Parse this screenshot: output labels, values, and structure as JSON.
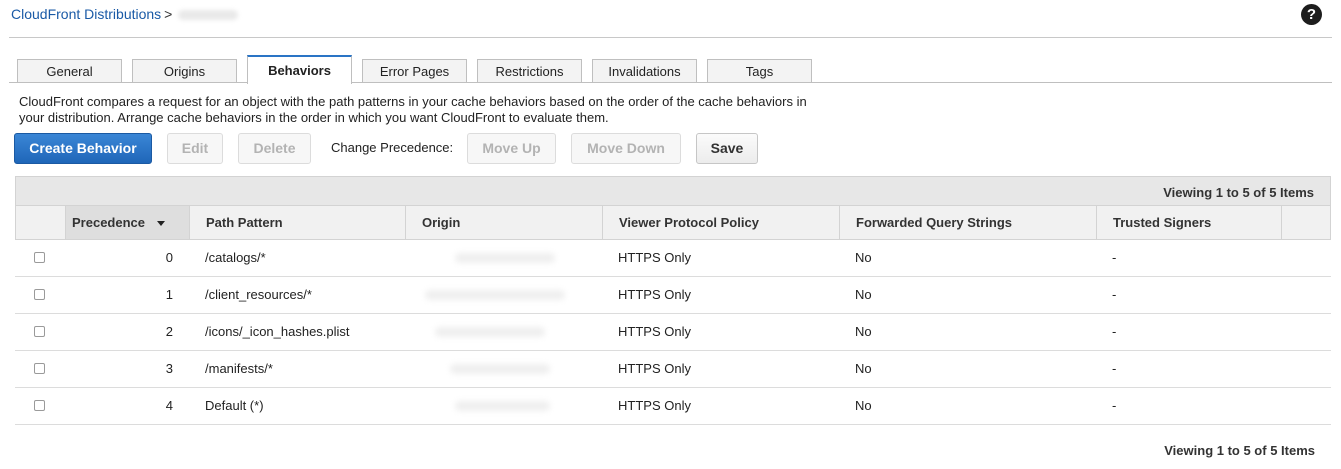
{
  "breadcrumb": {
    "link": "CloudFront Distributions",
    "separator": ">"
  },
  "help": {
    "glyph": "?"
  },
  "tabs": [
    {
      "label": "General",
      "active": false
    },
    {
      "label": "Origins",
      "active": false
    },
    {
      "label": "Behaviors",
      "active": true
    },
    {
      "label": "Error Pages",
      "active": false
    },
    {
      "label": "Restrictions",
      "active": false
    },
    {
      "label": "Invalidations",
      "active": false
    },
    {
      "label": "Tags",
      "active": false
    }
  ],
  "description": "CloudFront compares a request for an object with the path patterns in your cache behaviors based on the order of the cache behaviors in your distribution. Arrange cache behaviors in the order in which you want CloudFront to evaluate them.",
  "toolbar": {
    "create": "Create Behavior",
    "edit": "Edit",
    "delete": "Delete",
    "precedence_label": "Change Precedence:",
    "move_up": "Move Up",
    "move_down": "Move Down",
    "save": "Save"
  },
  "grid": {
    "viewing_top": "Viewing 1 to 5 of 5 Items",
    "viewing_bottom": "Viewing 1 to 5 of 5 Items",
    "columns": {
      "precedence": "Precedence",
      "path_pattern": "Path Pattern",
      "origin": "Origin",
      "viewer_protocol_policy": "Viewer Protocol Policy",
      "forwarded_query_strings": "Forwarded Query Strings",
      "trusted_signers": "Trusted Signers"
    },
    "rows": [
      {
        "precedence": "0",
        "path": "/catalogs/*",
        "policy": "HTTPS Only",
        "query": "No",
        "signers": "-"
      },
      {
        "precedence": "1",
        "path": "/client_resources/*",
        "policy": "HTTPS Only",
        "query": "No",
        "signers": "-"
      },
      {
        "precedence": "2",
        "path": "/icons/_icon_hashes.plist",
        "policy": "HTTPS Only",
        "query": "No",
        "signers": "-"
      },
      {
        "precedence": "3",
        "path": "/manifests/*",
        "policy": "HTTPS Only",
        "query": "No",
        "signers": "-"
      },
      {
        "precedence": "4",
        "path": "Default (*)",
        "policy": "HTTPS Only",
        "query": "No",
        "signers": "-"
      }
    ]
  }
}
